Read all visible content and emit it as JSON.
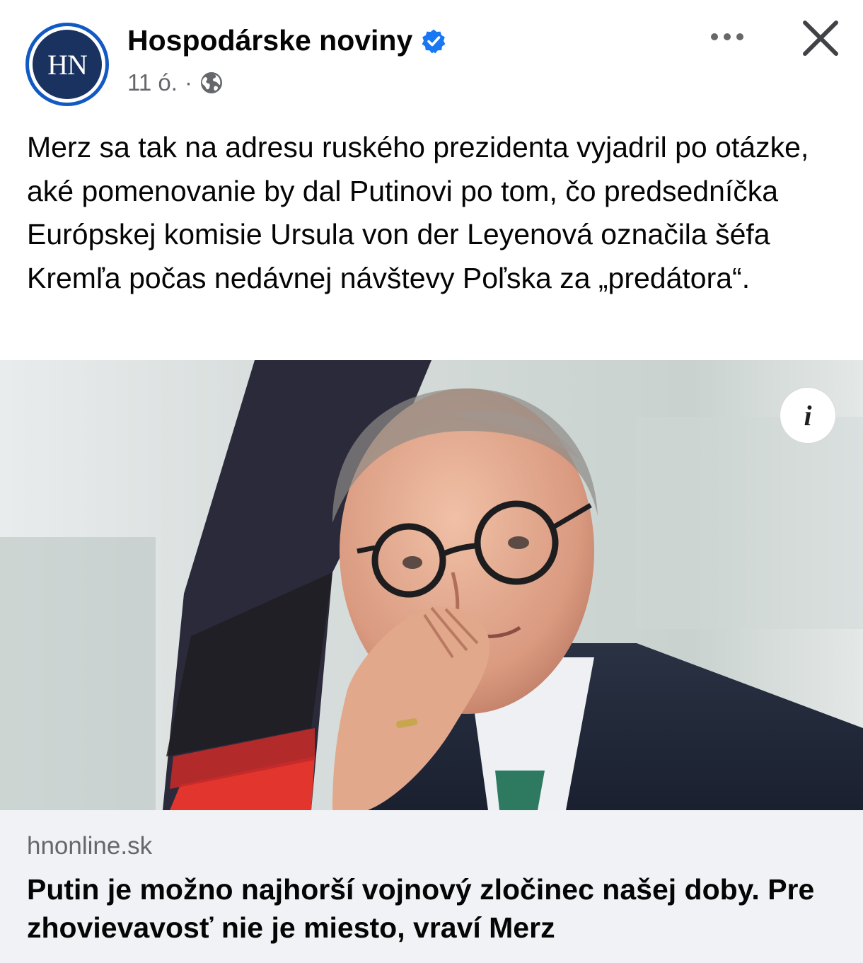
{
  "post": {
    "page_name": "Hospodárske noviny",
    "avatar_text": "HN",
    "timestamp": "11 ó.",
    "separator": "·",
    "text": "Merz sa tak na adresu ruského prezidenta vyjadril po otázke, aké pomenovanie by dal Putinovi po tom, čo predsedníčka Európskej komisie Ursula von der Leyenová označila šéfa Kremľa počas nedávnej návštevy Poľska za „predátora“."
  },
  "link_preview": {
    "domain": "hnonline.sk",
    "headline": "Putin je možno najhorší vojnový zločinec našej doby. Pre zhovievavosť nie je miesto, vraví Merz",
    "info_label": "i"
  },
  "icons": {
    "verified": "verified-badge-icon",
    "privacy": "globe-icon",
    "more": "more-options-icon",
    "close": "close-icon",
    "info": "info-icon"
  },
  "colors": {
    "verified_blue": "#1877f2",
    "secondary_text": "#65676b",
    "link_box_bg": "#f0f2f5",
    "avatar_navy": "#1a3260",
    "avatar_ring": "#1259c3"
  }
}
